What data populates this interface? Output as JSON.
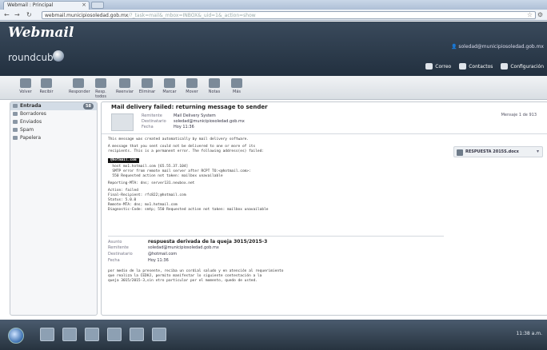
{
  "browser": {
    "tab_title": "Webmail : Principal",
    "url_host": "webmail.municipiosoledad.gob.mx",
    "url_rest": "/?_task=mail&_mbox=INBOX&_uid=1&_action=show"
  },
  "header": {
    "brand": "Webmail",
    "logo": "roundcube",
    "user": "soledad@municipiosoledad.gob.mx",
    "nav": [
      {
        "label": "Correo",
        "active": true
      },
      {
        "label": "Contactos",
        "active": false
      },
      {
        "label": "Configuración",
        "active": false
      }
    ]
  },
  "toolbar": {
    "items": [
      "Volver",
      "Recibir",
      "Responder",
      "Resp. todos",
      "Reenviar",
      "Eliminar",
      "Marcar",
      "Mover",
      "Notas",
      "Más"
    ]
  },
  "sidebar": {
    "folders": [
      {
        "label": "Entrada",
        "count": "58",
        "selected": true,
        "icon": "inbox-icon"
      },
      {
        "label": "Borradores",
        "count": "",
        "selected": false,
        "icon": "drafts-icon"
      },
      {
        "label": "Enviados",
        "count": "",
        "selected": false,
        "icon": "sent-icon"
      },
      {
        "label": "Spam",
        "count": "",
        "selected": false,
        "icon": "spam-icon"
      },
      {
        "label": "Papelera",
        "count": "",
        "selected": false,
        "icon": "trash-icon"
      }
    ]
  },
  "message": {
    "subject": "Mail delivery failed: returning message to sender",
    "counter": "Mensaje 1 de 913",
    "from_label": "Remitente",
    "from": "Mail Delivery System",
    "to_label": "Destinatario",
    "to": "soledad@municipiosoledad.gob.mx",
    "date_label": "Fecha",
    "date": "Hoy 11:36",
    "body_p1": "This message was created automatically by mail delivery software.",
    "body_p2": "A message that you sent could not be delivered to one or more of its\nrecipients. This is a permanent error. The following address(es) failed:",
    "failed_addr": "@hotmail.com",
    "body_p3": "  host mx1.hotmail.com [65.55.37.104]\n  SMTP error from remote mail server after RCPT TO:<@hotmail.com>:\n  550 Requested action not taken: mailbox unavailable",
    "body_p4": "Reporting-MTA: dns; server131.neubox.net",
    "body_p5": "Action: failed\nFinal-Recipient: rfc822;@hotmail.com\nStatus: 5.0.0\nRemote-MTA: dns; mx1.hotmail.com\nDiagnostic-Code: smtp; 550 Requested action not taken: mailbox unavailable",
    "attachment": "RESPUESTA 2015S.docx"
  },
  "embedded": {
    "subject_label": "Asunto",
    "subject": "respuesta derivada de la queja 3015/2015-3",
    "from_label": "Remitente",
    "from": "soledad@municipiosoledad.gob.mx",
    "to_label": "Destinatario",
    "to": "@hotmail.com",
    "date_label": "Fecha",
    "date": "Hoy 11:36",
    "body": "por medio de la presente, reciba un cordial saludo y en atención al requerimiento\nque realiza la CEDHJ, permito manifestar lo siguiente contestación a la\nqueja 3015/2015-3,sin otro particular por el momento, quedo de usted."
  },
  "taskbar": {
    "clock": "11:38 a.m."
  }
}
